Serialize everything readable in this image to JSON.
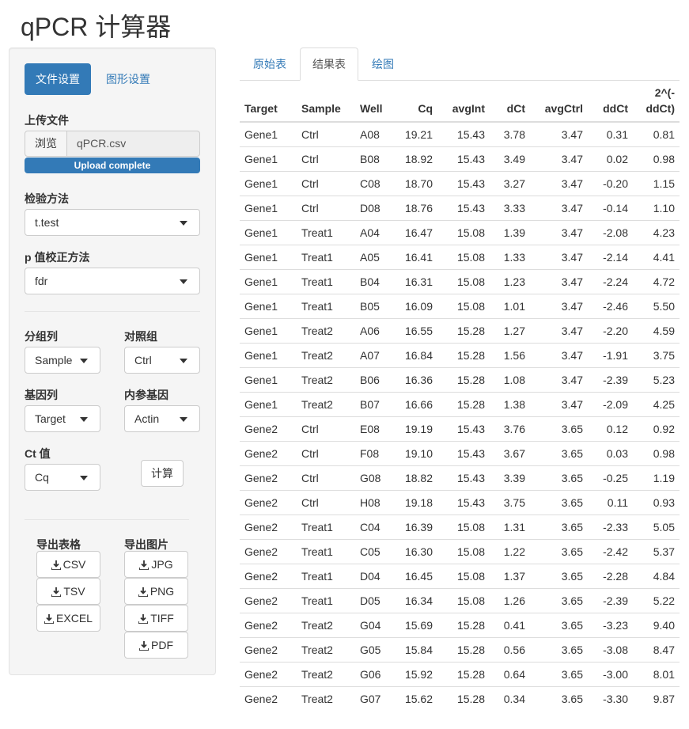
{
  "app": {
    "title": "qPCR 计算器"
  },
  "sidebar": {
    "tabs": [
      {
        "label": "文件设置",
        "active": true
      },
      {
        "label": "图形设置",
        "active": false
      }
    ],
    "upload": {
      "label": "上传文件",
      "browse_label": "浏览",
      "file_name": "qPCR.csv",
      "progress_text": "Upload complete",
      "progress": 1.0
    },
    "test_method": {
      "label": "检验方法",
      "value": "t.test"
    },
    "p_adjust": {
      "label": "p 值校正方法",
      "value": "fdr"
    },
    "group_col": {
      "label": "分组列",
      "value": "Sample"
    },
    "control_group": {
      "label": "对照组",
      "value": "Ctrl"
    },
    "gene_col": {
      "label": "基因列",
      "value": "Target"
    },
    "ref_gene": {
      "label": "内参基因",
      "value": "Actin"
    },
    "ct_value": {
      "label": "Ct 值",
      "value": "Cq"
    },
    "calculate_label": "计算",
    "export_table": {
      "label": "导出表格",
      "buttons": [
        "CSV",
        "TSV",
        "EXCEL"
      ]
    },
    "export_figure": {
      "label": "导出图片",
      "buttons": [
        "JPG",
        "PNG",
        "TIFF",
        "PDF"
      ]
    }
  },
  "main": {
    "tabs": [
      {
        "label": "原始表",
        "active": false
      },
      {
        "label": "结果表",
        "active": true
      },
      {
        "label": "绘图",
        "active": false
      }
    ],
    "table": {
      "columns": [
        {
          "label": "Target",
          "align": "l"
        },
        {
          "label": "Sample",
          "align": "l"
        },
        {
          "label": "Well",
          "align": "l"
        },
        {
          "label": "Cq",
          "align": "r"
        },
        {
          "label": "avgInt",
          "align": "r"
        },
        {
          "label": "dCt",
          "align": "r"
        },
        {
          "label": "avgCtrl",
          "align": "r"
        },
        {
          "label": "ddCt",
          "align": "r"
        },
        {
          "label": "2^(-ddCt)",
          "align": "r"
        }
      ],
      "rows": [
        [
          "Gene1",
          "Ctrl",
          "A08",
          "19.21",
          "15.43",
          "3.78",
          "3.47",
          "0.31",
          "0.81"
        ],
        [
          "Gene1",
          "Ctrl",
          "B08",
          "18.92",
          "15.43",
          "3.49",
          "3.47",
          "0.02",
          "0.98"
        ],
        [
          "Gene1",
          "Ctrl",
          "C08",
          "18.70",
          "15.43",
          "3.27",
          "3.47",
          "-0.20",
          "1.15"
        ],
        [
          "Gene1",
          "Ctrl",
          "D08",
          "18.76",
          "15.43",
          "3.33",
          "3.47",
          "-0.14",
          "1.10"
        ],
        [
          "Gene1",
          "Treat1",
          "A04",
          "16.47",
          "15.08",
          "1.39",
          "3.47",
          "-2.08",
          "4.23"
        ],
        [
          "Gene1",
          "Treat1",
          "A05",
          "16.41",
          "15.08",
          "1.33",
          "3.47",
          "-2.14",
          "4.41"
        ],
        [
          "Gene1",
          "Treat1",
          "B04",
          "16.31",
          "15.08",
          "1.23",
          "3.47",
          "-2.24",
          "4.72"
        ],
        [
          "Gene1",
          "Treat1",
          "B05",
          "16.09",
          "15.08",
          "1.01",
          "3.47",
          "-2.46",
          "5.50"
        ],
        [
          "Gene1",
          "Treat2",
          "A06",
          "16.55",
          "15.28",
          "1.27",
          "3.47",
          "-2.20",
          "4.59"
        ],
        [
          "Gene1",
          "Treat2",
          "A07",
          "16.84",
          "15.28",
          "1.56",
          "3.47",
          "-1.91",
          "3.75"
        ],
        [
          "Gene1",
          "Treat2",
          "B06",
          "16.36",
          "15.28",
          "1.08",
          "3.47",
          "-2.39",
          "5.23"
        ],
        [
          "Gene1",
          "Treat2",
          "B07",
          "16.66",
          "15.28",
          "1.38",
          "3.47",
          "-2.09",
          "4.25"
        ],
        [
          "Gene2",
          "Ctrl",
          "E08",
          "19.19",
          "15.43",
          "3.76",
          "3.65",
          "0.12",
          "0.92"
        ],
        [
          "Gene2",
          "Ctrl",
          "F08",
          "19.10",
          "15.43",
          "3.67",
          "3.65",
          "0.03",
          "0.98"
        ],
        [
          "Gene2",
          "Ctrl",
          "G08",
          "18.82",
          "15.43",
          "3.39",
          "3.65",
          "-0.25",
          "1.19"
        ],
        [
          "Gene2",
          "Ctrl",
          "H08",
          "19.18",
          "15.43",
          "3.75",
          "3.65",
          "0.11",
          "0.93"
        ],
        [
          "Gene2",
          "Treat1",
          "C04",
          "16.39",
          "15.08",
          "1.31",
          "3.65",
          "-2.33",
          "5.05"
        ],
        [
          "Gene2",
          "Treat1",
          "C05",
          "16.30",
          "15.08",
          "1.22",
          "3.65",
          "-2.42",
          "5.37"
        ],
        [
          "Gene2",
          "Treat1",
          "D04",
          "16.45",
          "15.08",
          "1.37",
          "3.65",
          "-2.28",
          "4.84"
        ],
        [
          "Gene2",
          "Treat1",
          "D05",
          "16.34",
          "15.08",
          "1.26",
          "3.65",
          "-2.39",
          "5.22"
        ],
        [
          "Gene2",
          "Treat2",
          "G04",
          "15.69",
          "15.28",
          "0.41",
          "3.65",
          "-3.23",
          "9.40"
        ],
        [
          "Gene2",
          "Treat2",
          "G05",
          "15.84",
          "15.28",
          "0.56",
          "3.65",
          "-3.08",
          "8.47"
        ],
        [
          "Gene2",
          "Treat2",
          "G06",
          "15.92",
          "15.28",
          "0.64",
          "3.65",
          "-3.00",
          "8.01"
        ],
        [
          "Gene2",
          "Treat2",
          "G07",
          "15.62",
          "15.28",
          "0.34",
          "3.65",
          "-3.30",
          "9.87"
        ]
      ]
    }
  },
  "colors": {
    "primary": "#337ab7",
    "well_bg": "#f5f5f5",
    "border": "#dddddd"
  },
  "icons": {
    "download": "download-icon",
    "caret": "caret-down-icon"
  }
}
